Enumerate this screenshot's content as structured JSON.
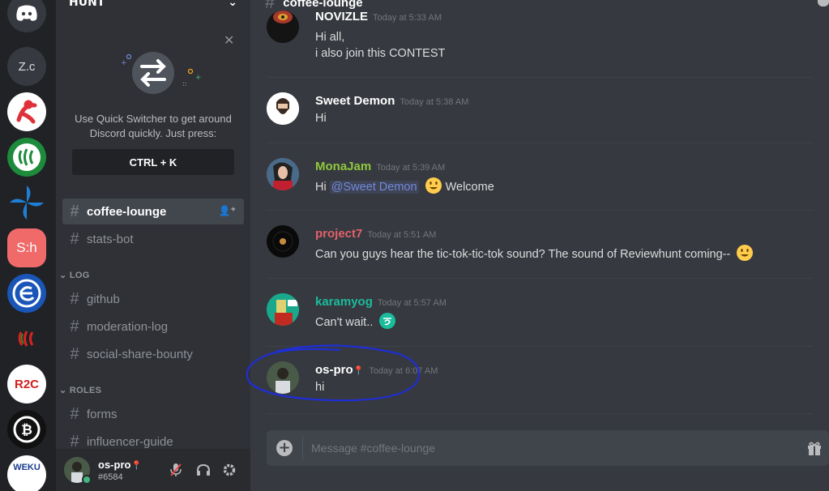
{
  "servers": [
    {
      "name": "discord-home-icon",
      "label": ""
    },
    {
      "name": "server-zc",
      "label": "Z.c"
    },
    {
      "name": "server-runner",
      "label": ""
    },
    {
      "name": "server-steem-green",
      "label": ""
    },
    {
      "name": "server-pinwheel",
      "label": ""
    },
    {
      "name": "server-sh",
      "label": "S:h"
    },
    {
      "name": "server-e-globe",
      "label": ""
    },
    {
      "name": "server-steem-small",
      "label": ""
    },
    {
      "name": "server-r2c",
      "label": "R2C"
    },
    {
      "name": "server-bitcoin",
      "label": ""
    },
    {
      "name": "server-weku",
      "label": "WEKU"
    }
  ],
  "sidebar": {
    "guild_name": "HUNT",
    "quick_switcher": {
      "text": "Use Quick Switcher to get around Discord quickly. Just press:",
      "shortcut": "CTRL + K"
    },
    "channels_top": [
      {
        "label": "coffee-lounge",
        "active": true
      },
      {
        "label": "stats-bot",
        "active": false
      }
    ],
    "category_log": "LOG",
    "channels_log": [
      {
        "label": "github"
      },
      {
        "label": "moderation-log"
      },
      {
        "label": "social-share-bounty"
      }
    ],
    "category_roles": "ROLES",
    "channels_roles": [
      {
        "label": "forms"
      },
      {
        "label": "influencer-guide"
      }
    ]
  },
  "user_panel": {
    "username": "os-pro",
    "badge": "📍",
    "discriminator": "#6584"
  },
  "chat": {
    "channel_name": "coffee-lounge",
    "messages": [
      {
        "author": "NOVIZLE",
        "timestamp": "Today at 5:33 AM",
        "lines": [
          "Hi all,",
          "i also join this CONTEST"
        ],
        "color": "#ffffff"
      },
      {
        "author": "Sweet Demon",
        "timestamp": "Today at 5:38 AM",
        "lines": [
          "Hi"
        ],
        "color": "#ffffff"
      },
      {
        "author": "MonaJam",
        "timestamp": "Today at 5:39 AM",
        "pre": "Hi ",
        "mention": "@Sweet Demon",
        "post": "Welcome",
        "color": "#8fc73e"
      },
      {
        "author": "project7",
        "timestamp": "Today at 5:51 AM",
        "lines": [
          "Can you guys hear the tic-tok-tic-tok sound? The sound of Reviewhunt coming--"
        ],
        "color": "#e0616b"
      },
      {
        "author": "karamyog",
        "timestamp": "Today at 5:57 AM",
        "lines": [
          "Can't wait.."
        ],
        "color": "#1abc9c"
      },
      {
        "author": "os-pro",
        "badge": "📍",
        "timestamp": "Today at 6:07 AM",
        "lines": [
          "hi"
        ],
        "color": "#ffffff"
      }
    ],
    "input_placeholder": "Message #coffee-lounge"
  }
}
